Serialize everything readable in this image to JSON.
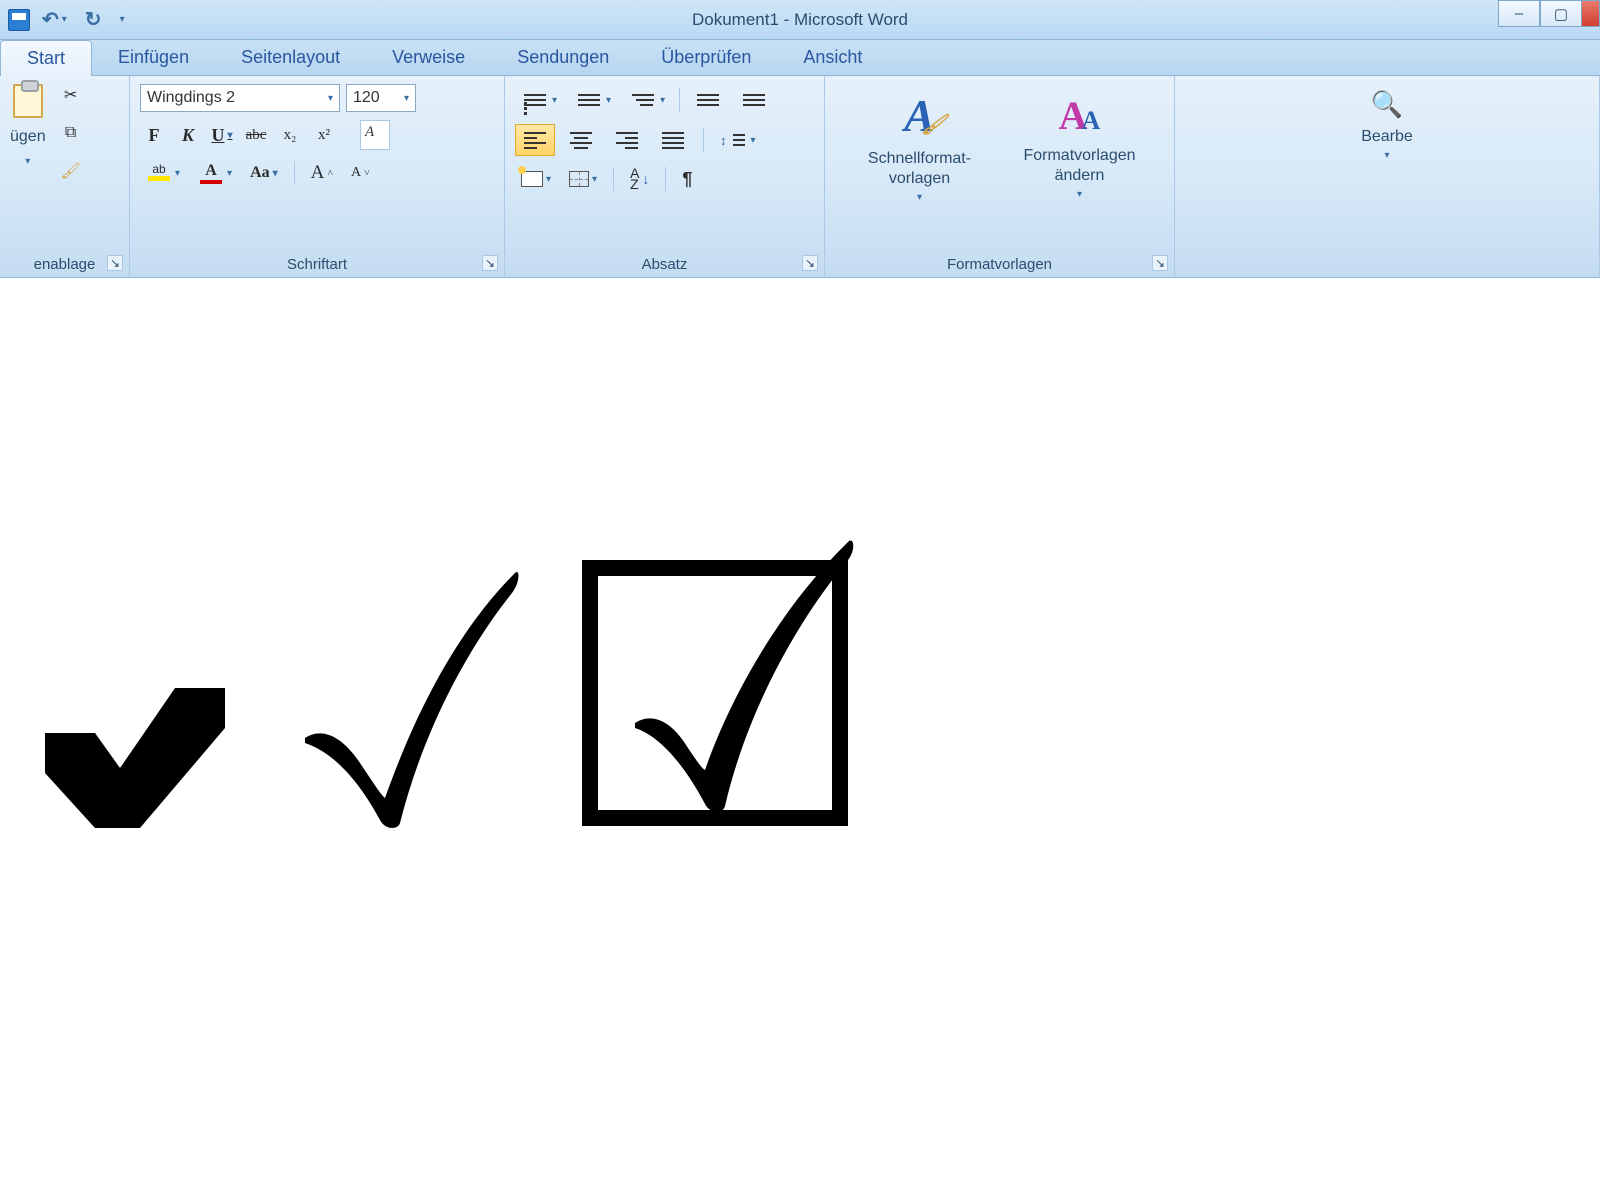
{
  "window": {
    "title": "Dokument1 - Microsoft Word"
  },
  "qat": {
    "undo_dd": "▾",
    "customize_dd": "▾"
  },
  "tabs": {
    "start": "Start",
    "einfuegen": "Einfügen",
    "seitenlayout": "Seitenlayout",
    "verweise": "Verweise",
    "sendungen": "Sendungen",
    "ueberpruefen": "Überprüfen",
    "ansicht": "Ansicht"
  },
  "clipboard": {
    "paste_label": "ügen",
    "group_label": "enablage"
  },
  "font": {
    "name": "Wingdings 2",
    "size": "120",
    "bold": "F",
    "italic": "K",
    "underline": "U",
    "strike": "abc",
    "subscript": "x₂",
    "superscript": "x²",
    "case": "Aa",
    "grow": "A˄",
    "shrink": "A˅",
    "highlight_glyph": "ab",
    "fontcolor_glyph": "A",
    "group_label": "Schriftart"
  },
  "paragraph": {
    "sort_a": "A",
    "sort_z": "Z",
    "pilcrow": "¶",
    "group_label": "Absatz"
  },
  "styles": {
    "quick_label": "Schnellformat-\nvorlagen",
    "change_label": "Formatvorlagen\nändern",
    "group_label": "Formatvorlagen"
  },
  "editing": {
    "label": "Bearbe"
  },
  "win": {
    "min": "–",
    "max": "▢"
  },
  "dd": "▾"
}
